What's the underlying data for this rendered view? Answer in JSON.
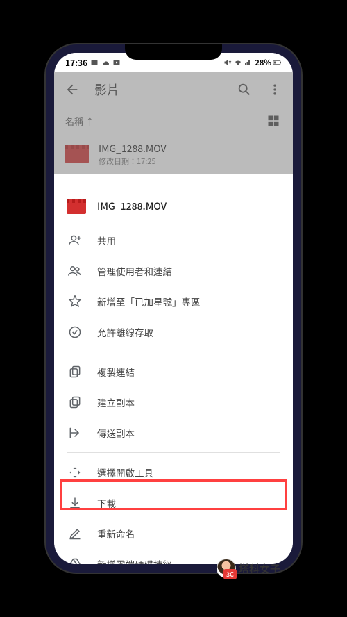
{
  "status": {
    "time": "17:36",
    "battery": "28%"
  },
  "header": {
    "title": "影片"
  },
  "sort": {
    "label": "名稱 ↑"
  },
  "file": {
    "name": "IMG_1288.MOV",
    "meta": "修改日期：17:25"
  },
  "sheet": {
    "title": "IMG_1288.MOV",
    "items": {
      "share": "共用",
      "manage": "管理使用者和連結",
      "star": "新增至「已加星號」專區",
      "offline": "允許離線存取",
      "copylink": "複製連結",
      "makecopy": "建立副本",
      "sendcopy": "傳送副本",
      "openwith": "選擇開啟工具",
      "download": "下載",
      "rename": "重新命名",
      "shortcut": "新增雲端硬碟捷徑"
    }
  },
  "watermark": "塔科女子"
}
